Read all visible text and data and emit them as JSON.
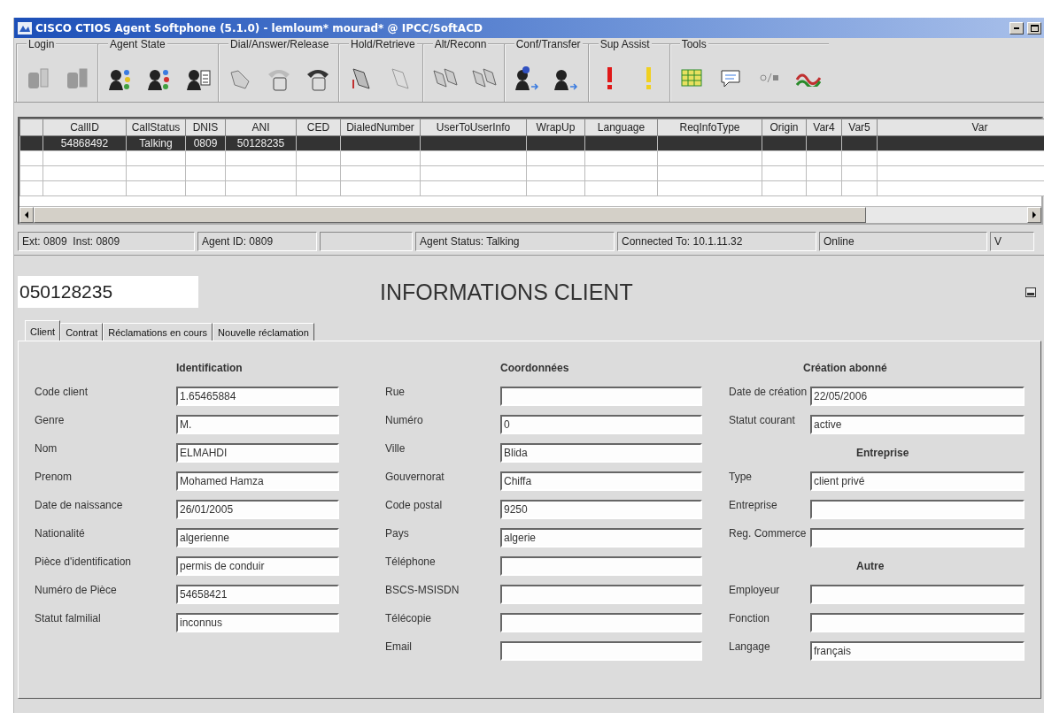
{
  "window": {
    "title": "CISCO CTIOS Agent Softphone (5.1.0) - lemloum* mourad* @ IPCC/SoftACD"
  },
  "toolbar": [
    {
      "label": "Login",
      "icons": [
        {
          "kind": "login"
        },
        {
          "kind": "logout"
        }
      ]
    },
    {
      "label": "Agent State",
      "icons": [
        {
          "kind": "ready"
        },
        {
          "kind": "not-ready"
        },
        {
          "kind": "work"
        }
      ]
    },
    {
      "label": "Dial/Answer/Release",
      "icons": [
        {
          "kind": "dial"
        },
        {
          "kind": "answer"
        },
        {
          "kind": "release"
        }
      ]
    },
    {
      "label": "Hold/Retrieve",
      "icons": [
        {
          "kind": "hold"
        },
        {
          "kind": "retrieve"
        }
      ]
    },
    {
      "label": "Alt/Reconn",
      "icons": [
        {
          "kind": "alternate"
        },
        {
          "kind": "reconnect"
        }
      ]
    },
    {
      "label": "Conf/Transfer",
      "icons": [
        {
          "kind": "conference"
        },
        {
          "kind": "transfer"
        }
      ]
    },
    {
      "label": "Sup Assist",
      "icons": [
        {
          "kind": "alert",
          "color": "#e01818"
        },
        {
          "kind": "alert",
          "color": "#f0d020"
        }
      ]
    },
    {
      "label": "Tools",
      "icons": [
        {
          "kind": "table"
        },
        {
          "kind": "chat"
        },
        {
          "kind": "toggle"
        },
        {
          "kind": "wave"
        }
      ]
    }
  ],
  "calls": {
    "columns": [
      "CallID",
      "CallStatus",
      "DNIS",
      "ANI",
      "CED",
      "DialedNumber",
      "UserToUserInfo",
      "WrapUp",
      "Language",
      "ReqInfoType",
      "Origin",
      "Var4",
      "Var5",
      "Var"
    ],
    "rows": [
      {
        "selected": true,
        "cells": [
          "54868492",
          "Talking",
          "0809",
          "50128235"
        ]
      }
    ]
  },
  "status_bar": [
    "Ext: 0809  Inst: 0809",
    "Agent ID: 0809",
    "Agent Status: Talking",
    "Connected To: 10.1.11.32",
    "Online",
    "V"
  ],
  "phone_number": "050128235",
  "heading": "INFORMATIONS CLIENT",
  "tabs": [
    {
      "label": "Client",
      "selected": true
    },
    {
      "label": "Contrat",
      "selected": false
    },
    {
      "label": "Réclamations en cours",
      "selected": false
    },
    {
      "label": "Nouvelle réclamation",
      "selected": false
    }
  ],
  "columns": [
    [
      {
        "heading": "Identification",
        "fields": [
          {
            "label": "Code client",
            "value": "1.65465884"
          },
          {
            "label": "Genre",
            "value": "M."
          },
          {
            "label": "Nom",
            "value": "ELMAHDI"
          },
          {
            "label": "Prenom",
            "value": "Mohamed Hamza"
          },
          {
            "label": "Date de naissance",
            "value": "26/01/2005"
          },
          {
            "label": "Nationalité",
            "value": "algerienne"
          },
          {
            "label": "Pièce d'identification",
            "value": "permis de conduir"
          },
          {
            "label": "Numéro de Pièce",
            "value": "54658421"
          },
          {
            "label": "Statut falmilial",
            "value": "inconnus"
          }
        ]
      }
    ],
    [
      {
        "heading": "Coordonnées",
        "fields": [
          {
            "label": "Rue"
          },
          {
            "label": "Numéro",
            "value": "0"
          },
          {
            "label": "Ville",
            "value": "Blida"
          },
          {
            "label": "Gouvernorat",
            "value": "Chiffa"
          },
          {
            "label": "Code postal",
            "value": "9250"
          },
          {
            "label": "Pays",
            "value": "algerie"
          },
          {
            "label": "Téléphone"
          },
          {
            "label": "BSCS-MSISDN"
          },
          {
            "label": "Télécopie"
          },
          {
            "label": "Email"
          }
        ]
      }
    ],
    [
      {
        "heading": "Création abonné",
        "fields": [
          {
            "label": "Date de création",
            "value": "22/05/2006"
          },
          {
            "label": "Statut courant",
            "value": "active"
          }
        ]
      },
      {
        "heading": "Entreprise",
        "fields": [
          {
            "label": "Type",
            "value": "client privé"
          },
          {
            "label": "Entreprise"
          },
          {
            "label": "Reg. Commerce"
          }
        ]
      },
      {
        "heading": "Autre",
        "fields": [
          {
            "label": "Employeur"
          },
          {
            "label": "Fonction"
          },
          {
            "label": "Langage",
            "value": "français"
          }
        ]
      }
    ]
  ]
}
